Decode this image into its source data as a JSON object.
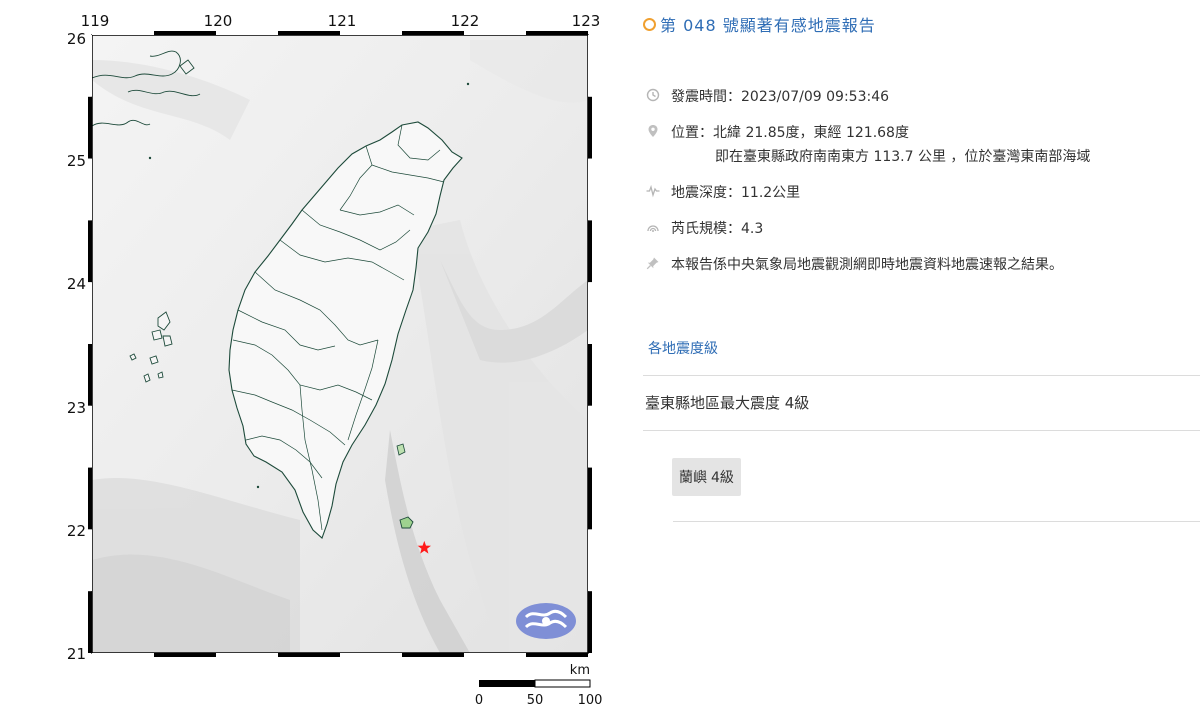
{
  "map": {
    "lon_ticks": [
      "119",
      "120",
      "121",
      "122",
      "123"
    ],
    "lat_ticks": [
      "26",
      "25",
      "24",
      "23",
      "22",
      "21"
    ],
    "scale_unit": "km",
    "scale_ticks": [
      "0",
      "50",
      "100"
    ],
    "epicenter": {
      "lat": 21.85,
      "lon": 121.68,
      "color": "#ff1a1a"
    },
    "colors": {
      "coast": "#1d4a3a",
      "frame": "#000000",
      "relief": "#e8e8e8",
      "logo": "#7f8fd6"
    }
  },
  "report": {
    "title": "第 048 號顯著有感地震報告",
    "time": "發震時間：2023/07/09 09:53:46",
    "location_line1": "位置：北緯 21.85度，東經 121.68度",
    "location_line2": "即在臺東縣政府南南東方 113.7 公里 ，位於臺灣東南部海域",
    "depth": "地震深度：11.2公里",
    "magnitude": "芮氏規模：4.3",
    "note": "本報告係中央氣象局地震觀測網即時地震資料地震速報之結果。",
    "icons": [
      "clock-icon",
      "location-pin-icon",
      "seismic-wave-icon",
      "magnitude-icon",
      "pushpin-icon"
    ]
  },
  "intensity": {
    "section_label": "各地震度級",
    "max_line": "臺東縣地區最大震度 4級",
    "stations": [
      {
        "name": "蘭嶼",
        "level": "4級"
      }
    ]
  }
}
